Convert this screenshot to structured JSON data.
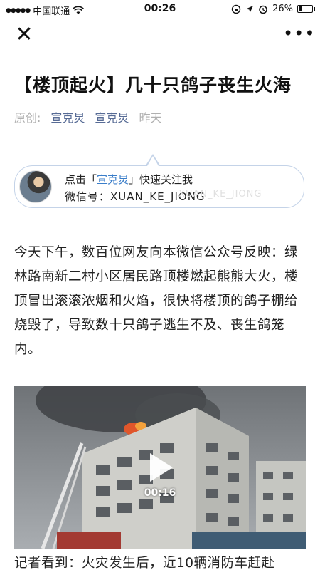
{
  "status_bar": {
    "carrier": "中国联通",
    "time": "00:26",
    "battery_percent": "26%",
    "battery_level": 0.26,
    "icons": [
      "signal-icon",
      "wifi-icon",
      "lock-rotation-icon",
      "location-icon",
      "alarm-icon",
      "battery-icon"
    ]
  },
  "navbar": {
    "close_icon": "close-icon",
    "more_icon": "more-icon",
    "close_glyph": "✕",
    "more_glyph": "•••"
  },
  "article": {
    "title": "【楼顶起火】几十只鸽子丧生火海",
    "original_label": "原创:",
    "author": "宣克炅",
    "account": "宣克炅",
    "date": "昨天",
    "follow_card": {
      "prefix": "点击「",
      "name": "宣克炅",
      "suffix": "」快速关注我",
      "wechat_id_line": "微信号：XUAN_KE_JIONG",
      "watermark": "XUAN_KE_JIONG"
    },
    "paragraph_1": "今天下午，数百位网友向本微信公众号反映：绿林路南新二村小区居民路顶楼燃起熊熊大火，楼顶冒出滚滚浓烟和火焰，很快将楼顶的鸽子棚给烧毁了，导致数十只鸽子逃生不及、丧生鸽笼内。",
    "video": {
      "duration": "00:16"
    },
    "paragraph_2": "记者看到：火灾发生后，近10辆消防车赶赴"
  },
  "colors": {
    "link": "#576b95",
    "card_name": "#3a7dc9",
    "meta_gray": "#b0b0b0"
  }
}
